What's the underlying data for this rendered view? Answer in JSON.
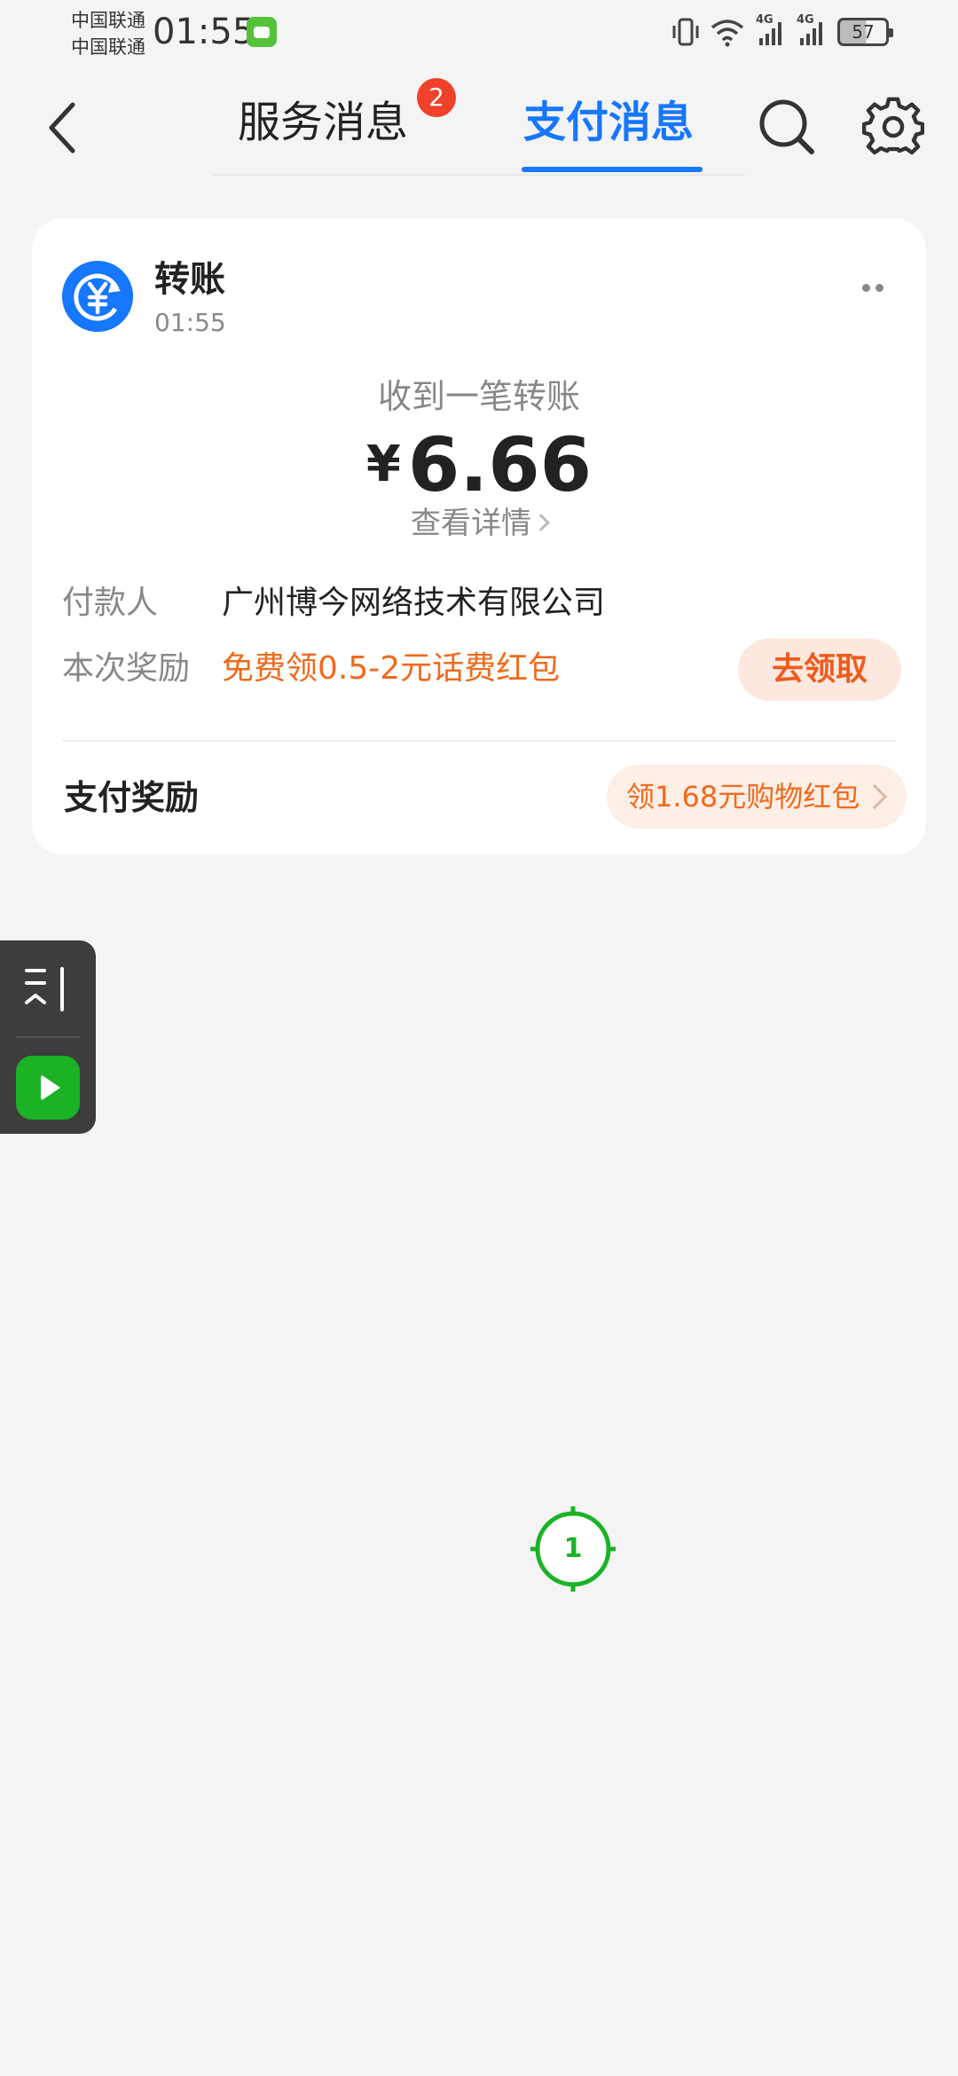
{
  "status_bar": {
    "carrier_1": "中国联通",
    "carrier_2": "中国联通",
    "time": "01:55",
    "network_1": "4G",
    "network_2": "4G",
    "battery": "57",
    "icons": [
      "vibrate-icon",
      "wifi-icon",
      "signal-icon",
      "signal-icon",
      "battery-icon"
    ]
  },
  "header": {
    "tabs": [
      {
        "label": "服务消息",
        "badge": "2"
      },
      {
        "label": "支付消息",
        "active": true
      }
    ],
    "accent_color": "#1677ff"
  },
  "card": {
    "title": "转账",
    "time": "01:55",
    "received_text": "收到一笔转账",
    "currency": "¥",
    "amount": "6.66",
    "detail_link": "查看详情",
    "payer_label": "付款人",
    "payer_value": "广州博今网络技术有限公司",
    "reward_label": "本次奖励",
    "reward_value": "免费领0.5-2元话费红包",
    "claim_button": "去领取",
    "pay_reward_title": "支付奖励",
    "shop_reward": "领1.68元购物红包"
  },
  "touch_marker": {
    "label": "1"
  }
}
